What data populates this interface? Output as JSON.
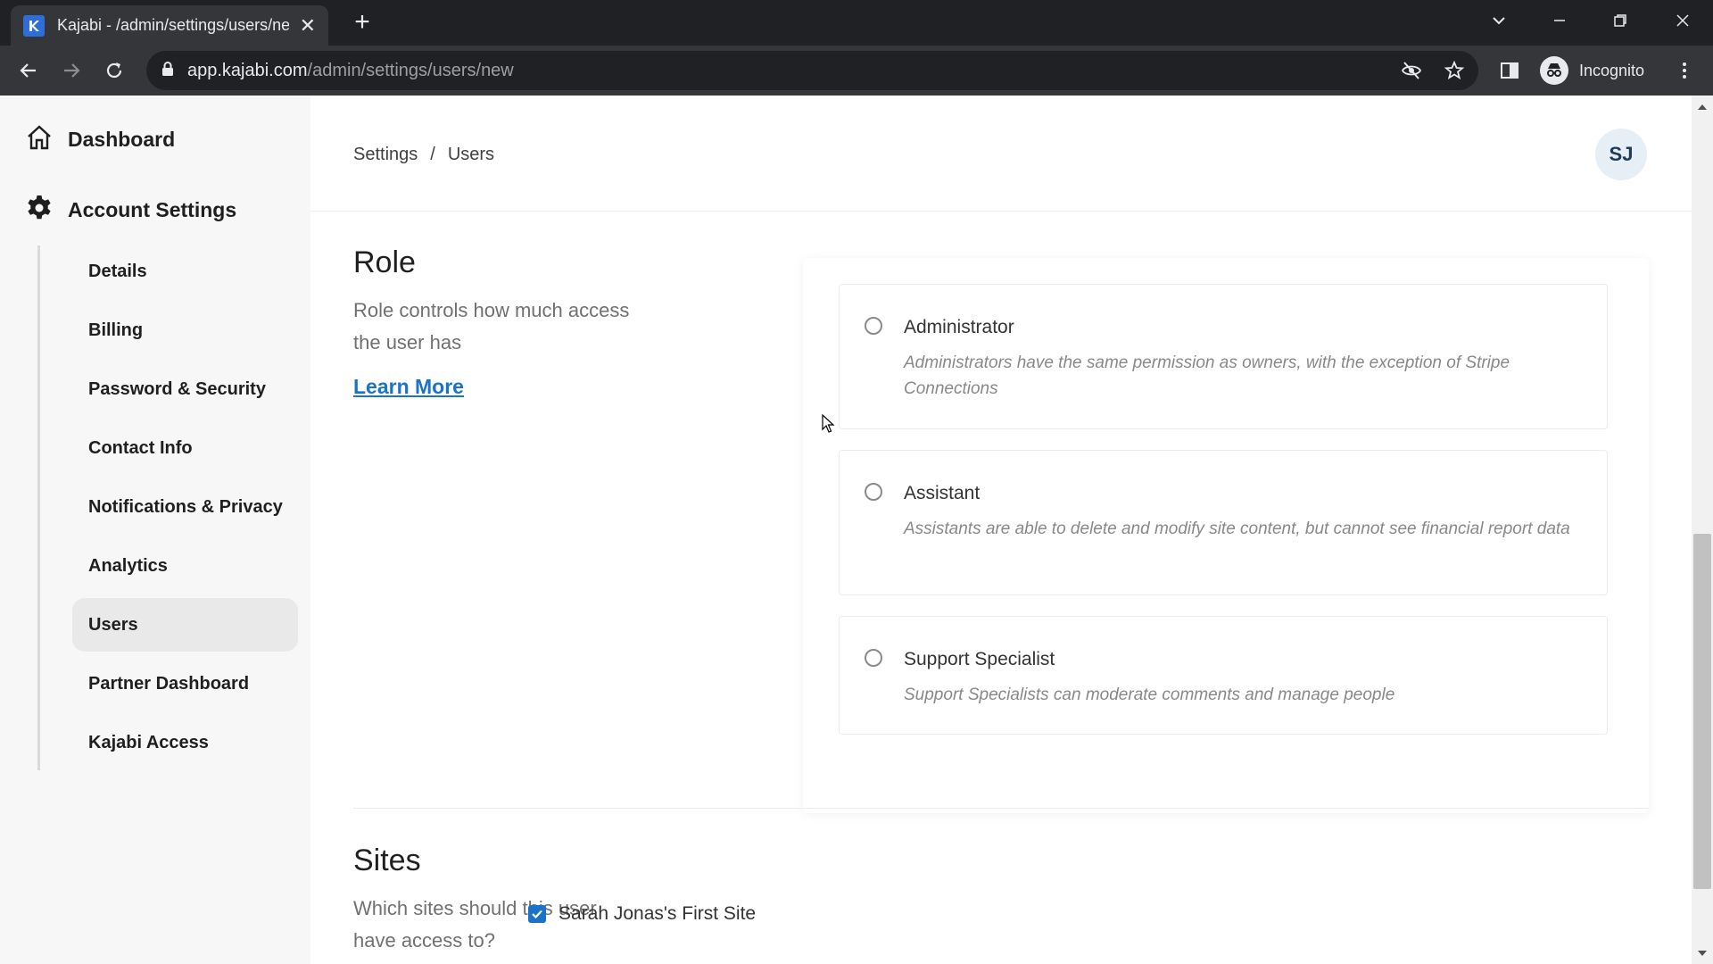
{
  "browser": {
    "tab_title": "Kajabi - /admin/settings/users/new",
    "url_host": "app.kajabi.com",
    "url_path": "/admin/settings/users/new",
    "profile_label": "Incognito"
  },
  "sidebar": {
    "dashboard": "Dashboard",
    "account_settings": "Account Settings",
    "items": [
      {
        "label": "Details"
      },
      {
        "label": "Billing"
      },
      {
        "label": "Password & Security"
      },
      {
        "label": "Contact Info"
      },
      {
        "label": "Notifications & Privacy"
      },
      {
        "label": "Analytics"
      },
      {
        "label": "Users"
      },
      {
        "label": "Partner Dashboard"
      },
      {
        "label": "Kajabi Access"
      }
    ],
    "active_item": "Users"
  },
  "header": {
    "breadcrumb": [
      "Settings",
      "/",
      "Users"
    ],
    "avatar_initials": "SJ"
  },
  "role_section": {
    "title": "Role",
    "description": "Role controls how much access the user has",
    "learn_more": "Learn More",
    "options": [
      {
        "name": "Administrator",
        "description": "Administrators have the same permission as owners, with the exception of Stripe Connections",
        "selected": false
      },
      {
        "name": "Assistant",
        "description": "Assistants are able to delete and modify site content, but cannot see financial report data",
        "selected": false
      },
      {
        "name": "Support Specialist",
        "description": "Support Specialists can moderate comments and manage people",
        "selected": false
      }
    ]
  },
  "sites_section": {
    "title": "Sites",
    "description": "Which sites should this user have access to?",
    "sites": [
      {
        "name": "Sarah Jonas's First Site",
        "checked": true
      }
    ]
  },
  "colors": {
    "accent": "#1a73c8",
    "sidebar_bg": "#f7f7f7",
    "chrome_dark": "#202124"
  }
}
